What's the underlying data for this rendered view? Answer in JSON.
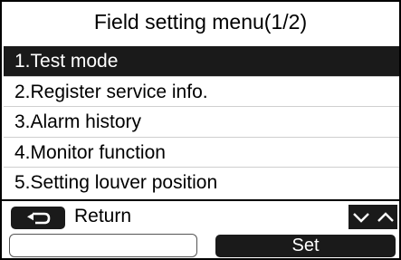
{
  "header": {
    "title": "Field setting menu(1/2)"
  },
  "menu": {
    "items": [
      {
        "label": "1.Test mode",
        "selected": true
      },
      {
        "label": "2.Register service info.",
        "selected": false
      },
      {
        "label": "3.Alarm history",
        "selected": false
      },
      {
        "label": "4.Monitor function",
        "selected": false
      },
      {
        "label": "5.Setting louver position",
        "selected": false
      }
    ]
  },
  "footer": {
    "return_label": "Return",
    "return_icon": "return-arrow-icon",
    "down_icon": "chevron-down-icon",
    "up_icon": "chevron-up-icon",
    "set_label": "Set"
  },
  "colors": {
    "selected_bg": "#1a1a1a",
    "selected_text": "#ffffff",
    "background": "#ffffff"
  }
}
